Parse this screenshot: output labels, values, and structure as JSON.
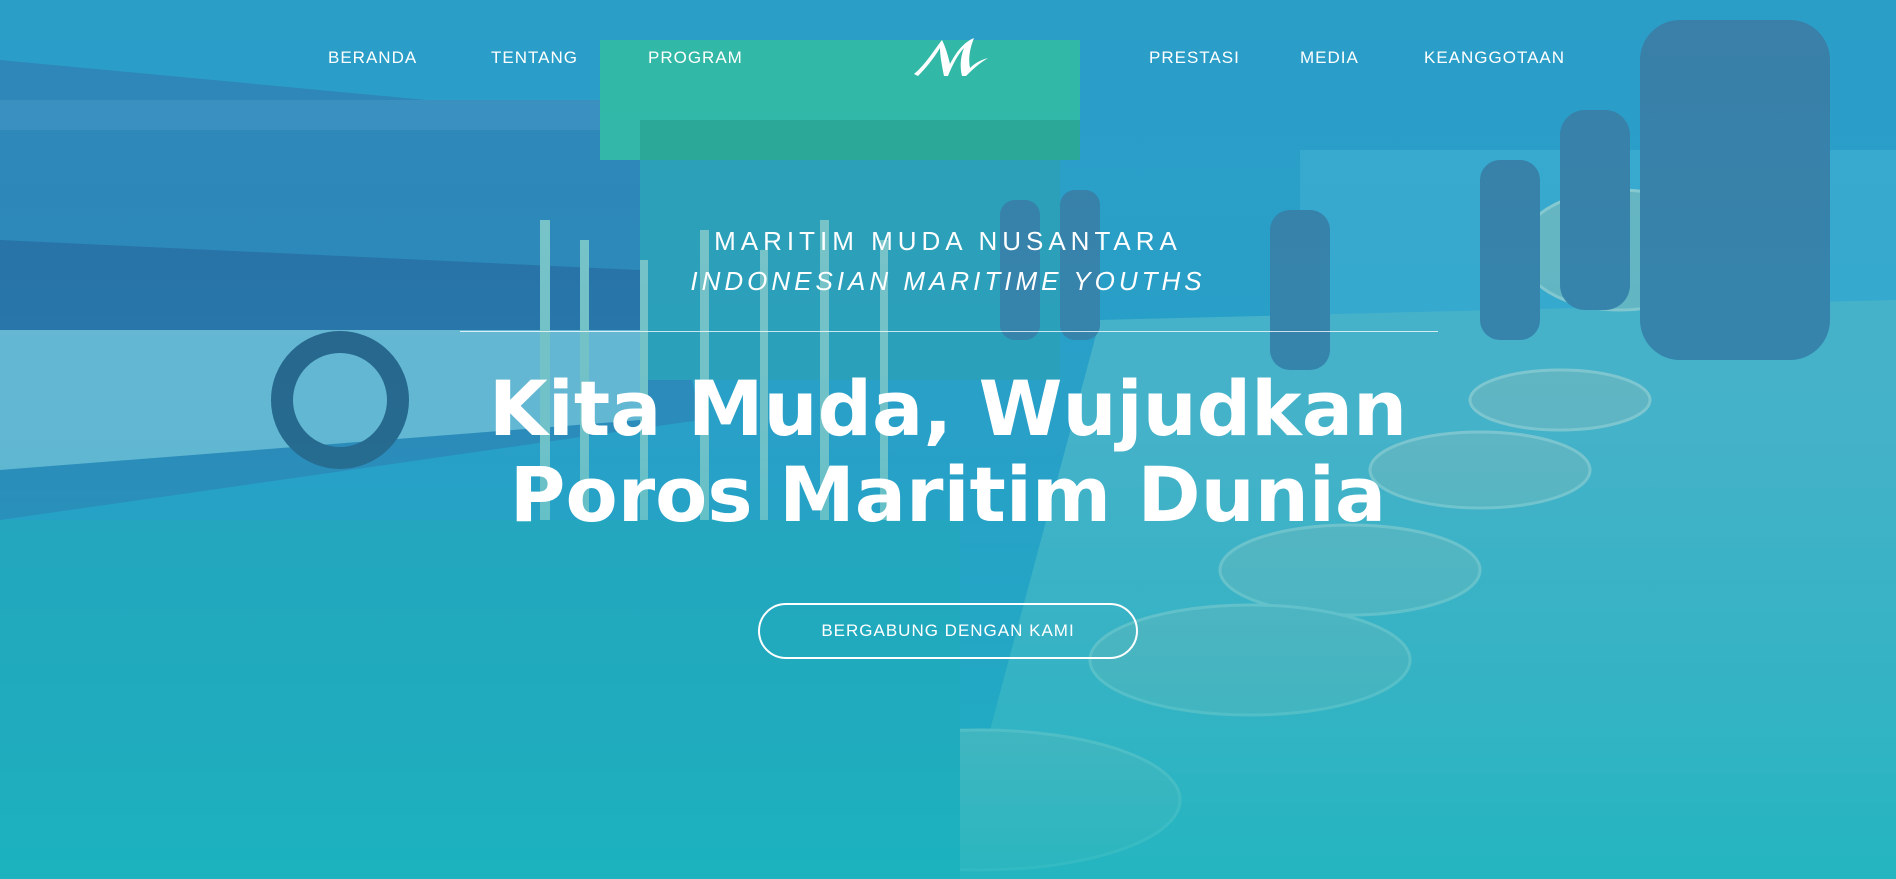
{
  "nav": {
    "left": [
      {
        "label": "BERANDA"
      },
      {
        "label": "TENTANG"
      },
      {
        "label": "PROGRAM"
      }
    ],
    "right": [
      {
        "label": "PRESTASI"
      },
      {
        "label": "MEDIA"
      },
      {
        "label": "KEANGGOTAAN"
      }
    ],
    "logo_icon": "mmn-logo-icon"
  },
  "hero": {
    "eyebrow_title": "MARITIM MUDA NUSANTARA",
    "eyebrow_subtitle": "INDONESIAN MARITIME YOUTHS",
    "headline_line1": "Kita Muda, Wujudkan",
    "headline_line2": "Poros Maritim Dunia",
    "cta_label": "BERGABUNG DENGAN KAMI",
    "overlay_color": "#1aa6b8"
  }
}
